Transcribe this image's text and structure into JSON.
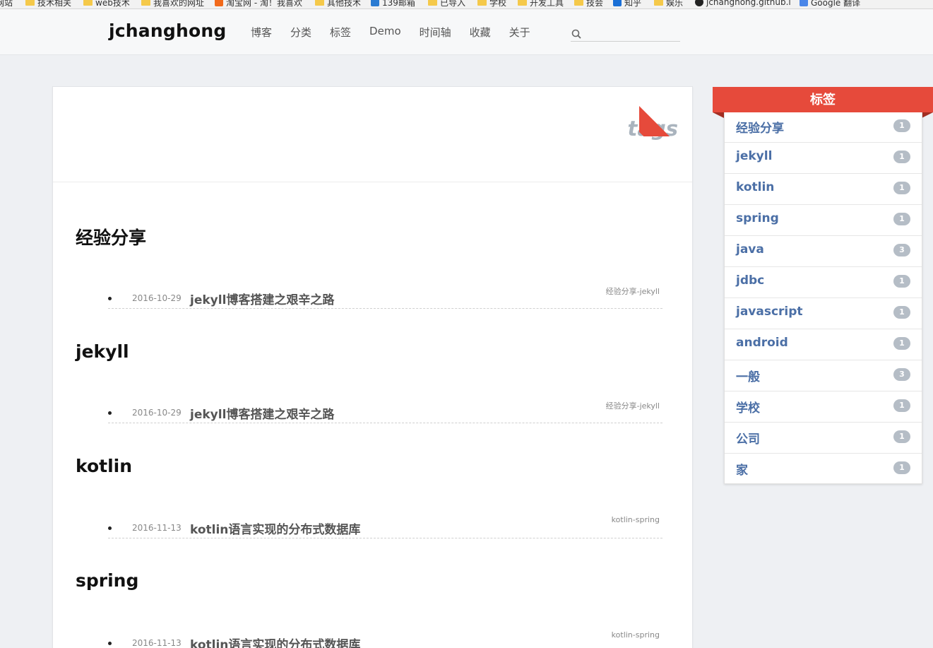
{
  "bookmarks": [
    {
      "label": "网站",
      "icon": "folder-icon"
    },
    {
      "label": "技术相关",
      "icon": "folder-icon"
    },
    {
      "label": "web技术",
      "icon": "folder-icon"
    },
    {
      "label": "我喜欢的网址",
      "icon": "folder-icon"
    },
    {
      "label": "淘宝网 - 淘！我喜欢",
      "icon": "taobao-icon"
    },
    {
      "label": "其他技术",
      "icon": "folder-icon"
    },
    {
      "label": "139邮箱",
      "icon": "mail-icon"
    },
    {
      "label": "已导入",
      "icon": "folder-icon"
    },
    {
      "label": "学校",
      "icon": "folder-icon"
    },
    {
      "label": "开发工具",
      "icon": "folder-icon"
    },
    {
      "label": "技会",
      "icon": "folder-icon"
    },
    {
      "label": "知乎",
      "icon": "zhihu-icon"
    },
    {
      "label": "娱乐",
      "icon": "folder-icon"
    },
    {
      "label": "jchanghong.github.i",
      "icon": "github-icon"
    },
    {
      "label": "Google 翻译",
      "icon": "translate-icon"
    }
  ],
  "header": {
    "logo": "jchanghong",
    "nav": [
      "博客",
      "分类",
      "标签",
      "Demo",
      "时间轴",
      "收藏",
      "关于"
    ],
    "search_placeholder": ""
  },
  "main": {
    "title": "tags",
    "sections": [
      {
        "name": "经验分享",
        "posts": [
          {
            "date": "2016-10-29",
            "title": "jekyll博客搭建之艰辛之路",
            "tags": "经验分享-jekyll"
          }
        ]
      },
      {
        "name": "jekyll",
        "posts": [
          {
            "date": "2016-10-29",
            "title": "jekyll博客搭建之艰辛之路",
            "tags": "经验分享-jekyll"
          }
        ]
      },
      {
        "name": "kotlin",
        "posts": [
          {
            "date": "2016-11-13",
            "title": "kotlin语言实现的分布式数据库",
            "tags": "kotlin-spring"
          }
        ]
      },
      {
        "name": "spring",
        "posts": [
          {
            "date": "2016-11-13",
            "title": "kotlin语言实现的分布式数据库",
            "tags": "kotlin-spring"
          }
        ]
      }
    ]
  },
  "sidebar": {
    "title": "标签",
    "tags": [
      {
        "name": "经验分享",
        "count": "1"
      },
      {
        "name": "jekyll",
        "count": "1"
      },
      {
        "name": "kotlin",
        "count": "1"
      },
      {
        "name": "spring",
        "count": "1"
      },
      {
        "name": "java",
        "count": "3"
      },
      {
        "name": "jdbc",
        "count": "1"
      },
      {
        "name": "javascript",
        "count": "1"
      },
      {
        "name": "android",
        "count": "1"
      },
      {
        "name": "一般",
        "count": "3"
      },
      {
        "name": "学校",
        "count": "1"
      },
      {
        "name": "公司",
        "count": "1"
      },
      {
        "name": "家",
        "count": "1"
      }
    ]
  },
  "colors": {
    "accent": "#e64a3b",
    "tag_link": "#4b6fa6",
    "badge": "#b5bdc6"
  }
}
